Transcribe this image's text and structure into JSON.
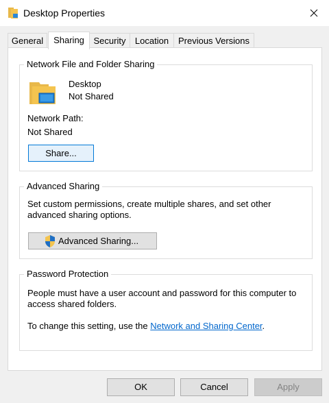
{
  "window": {
    "title": "Desktop Properties"
  },
  "tabs": [
    "General",
    "Sharing",
    "Security",
    "Location",
    "Previous Versions"
  ],
  "network_sharing": {
    "group_title": "Network File and Folder Sharing",
    "folder_name": "Desktop",
    "folder_status": "Not Shared",
    "path_label": "Network Path:",
    "path_value": "Not Shared",
    "share_button": "Share..."
  },
  "advanced_sharing": {
    "group_title": "Advanced Sharing",
    "description_line1": "Set custom permissions, create multiple shares, and set other",
    "description_line2": "advanced sharing options.",
    "button": "Advanced Sharing..."
  },
  "password_protection": {
    "group_title": "Password Protection",
    "line1": "People must have a user account and password for this computer to",
    "line2": "access shared folders.",
    "change_prefix": "To change this setting, use the ",
    "link": "Network and Sharing Center",
    "change_suffix": "."
  },
  "footer": {
    "ok": "OK",
    "cancel": "Cancel",
    "apply": "Apply"
  },
  "colors": {
    "link": "#0066cc",
    "focus_border": "#0078d7",
    "folder_yellow": "#f4c44f"
  }
}
